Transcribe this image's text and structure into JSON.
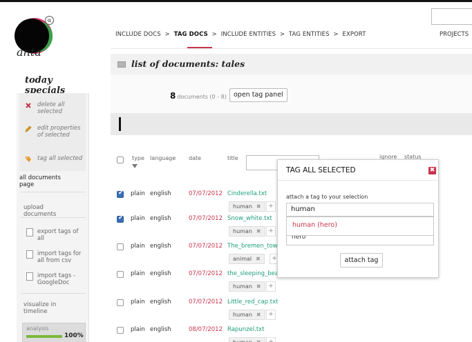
{
  "app": {
    "logo_text": "anta",
    "logo_badge": "α"
  },
  "nav": {
    "steps": [
      {
        "label": "INCLUDE DOCS"
      },
      {
        "label": "TAG DOCS"
      },
      {
        "label": "INCLUDE ENTITIES"
      },
      {
        "label": "TAG ENTITIES"
      },
      {
        "label": "EXPORT"
      }
    ],
    "separator": ">",
    "active_index": 1,
    "projects_label": "PROJECTS"
  },
  "sidebar": {
    "title": "today specials",
    "specials": [
      {
        "label": "delete all selected",
        "icon": "delete-icon"
      },
      {
        "label": "edit properties of selected",
        "icon": "pencil-icon"
      },
      {
        "label": "tag all selected",
        "icon": "tag-icon"
      }
    ],
    "items": [
      {
        "label": "all documents page"
      },
      {
        "label": "upload documents"
      },
      {
        "label": "export tags of all",
        "icon": "export-icon"
      },
      {
        "label": "import tags for all from csv",
        "icon": "import-icon"
      },
      {
        "label": "import tags - GoogleDoc",
        "icon": "import-icon"
      },
      {
        "label": "visualize in timeline"
      }
    ],
    "analysis": {
      "label": "analysis",
      "percent_text": "100%",
      "progress": 1.0
    }
  },
  "main": {
    "title": "list of documents: tales",
    "count": "8",
    "count_suffix": "documents (0 - 8)",
    "open_tag_panel_label": "open tag panel",
    "columns": [
      "type",
      "language",
      "date",
      "title",
      "ignore",
      "status"
    ],
    "rows": [
      {
        "type": "plain",
        "language": "english",
        "date": "07/07/2012",
        "title": "Cinderella.txt",
        "tag": "human",
        "checked": true
      },
      {
        "type": "plain",
        "language": "english",
        "date": "07/07/2012",
        "title": "Snow_white.txt",
        "tag": "human",
        "checked": true
      },
      {
        "type": "plain",
        "language": "english",
        "date": "07/07/2012",
        "title": "The_bremen_tow",
        "tag": "animal",
        "checked": false
      },
      {
        "type": "plain",
        "language": "english",
        "date": "07/07/2012",
        "title": "the_sleeping_bea",
        "tag": "human",
        "checked": false
      },
      {
        "type": "plain",
        "language": "english",
        "date": "07/07/2012",
        "title": "Little_red_cap.txt",
        "tag": "human",
        "checked": false
      },
      {
        "type": "plain",
        "language": "english",
        "date": "08/07/2012",
        "title": "Rapunzel.txt",
        "tag": "human",
        "checked": false
      }
    ],
    "tag_remove_glyph": "✖",
    "tag_add_glyph": "+"
  },
  "dialog": {
    "title": "TAG ALL SELECTED",
    "close_glyph": "✖",
    "label": "attach a tag to your selection",
    "input_value": "human",
    "suggestions": [
      "human (hero)",
      "hero"
    ],
    "attach_label": "attach tag"
  },
  "colors": {
    "accent": "#c8344c",
    "title_link": "#1e9e7a",
    "checkbox_on": "#3a6fb8",
    "progress": "#7ab83b"
  }
}
